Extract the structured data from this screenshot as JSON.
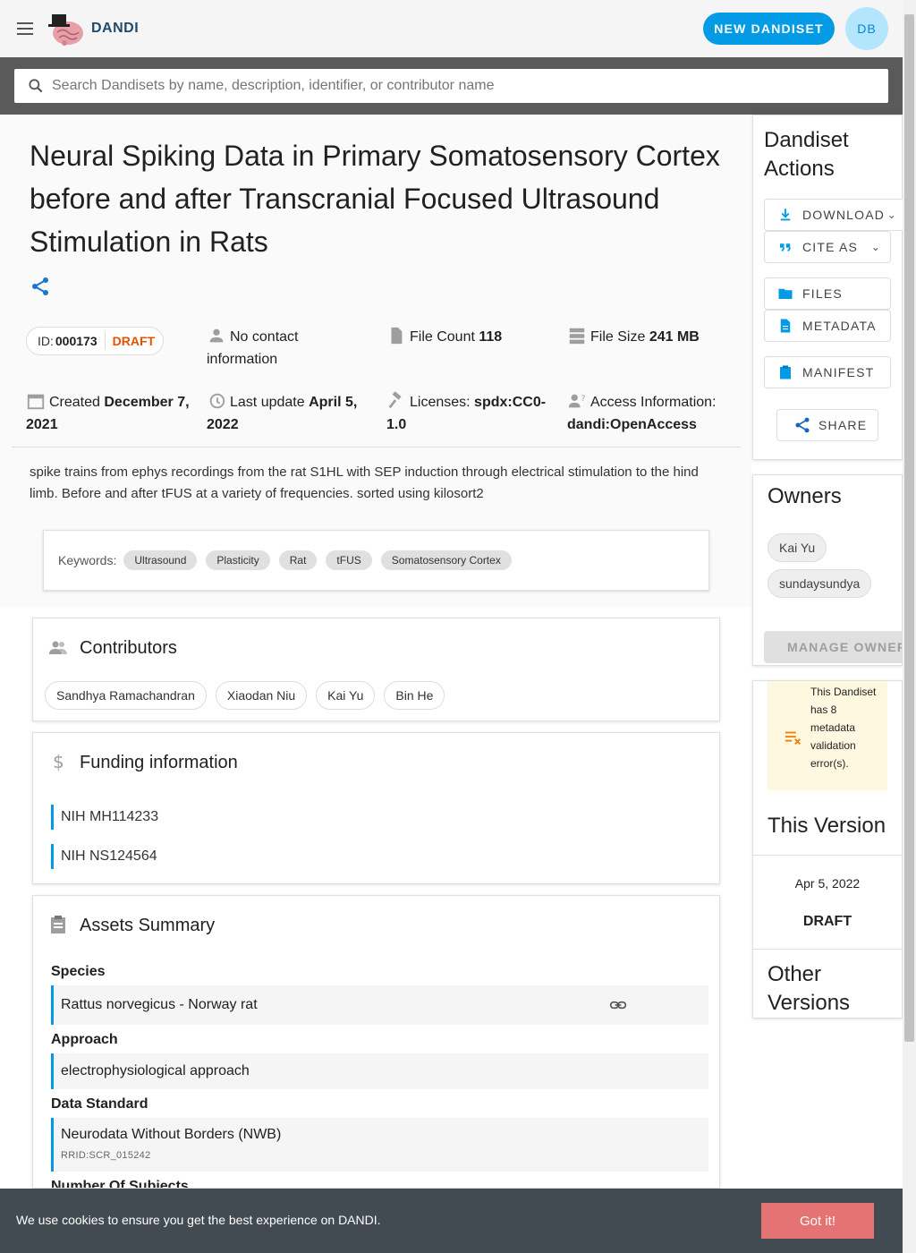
{
  "app": {
    "brand": "DANDI",
    "new_button": "NEW DANDISET",
    "avatar_initials": "DB"
  },
  "search": {
    "placeholder": "Search Dandisets by name, description, identifier, or contributor name"
  },
  "dandiset": {
    "title": "Neural Spiking Data in Primary Somatosensory Cortex before and after Transcranial Focused Ultrasound Stimulation in Rats",
    "id_label": "ID:",
    "id": "000173",
    "status": "DRAFT",
    "contact": "No contact information",
    "file_count_label": "File Count",
    "file_count": "118",
    "file_size_label": "File Size",
    "file_size": "241 MB",
    "created_label": "Created",
    "created": "December 7, 2021",
    "updated_label": "Last update",
    "updated": "April 5, 2022",
    "license_label": "Licenses:",
    "license": "spdx:CC0-1.0",
    "access_label": "Access Information:",
    "access": "dandi:OpenAccess",
    "description": "spike trains from ephys recordings from the rat S1HL with SEP induction through electrical stimulation to the hind limb. Before and after tFUS at a variety of frequencies. sorted using kilosort2",
    "keywords_label": "Keywords:",
    "keywords": [
      "Ultrasound",
      "Plasticity",
      "Rat",
      "tFUS",
      "Somatosensory Cortex"
    ]
  },
  "contributors": {
    "title": "Contributors",
    "people": [
      "Sandhya Ramachandran",
      "Xiaodan Niu",
      "Kai Yu",
      "Bin He"
    ]
  },
  "funding": {
    "title": "Funding information",
    "items": [
      "NIH MH114233",
      "NIH NS124564"
    ]
  },
  "assets": {
    "title": "Assets Summary",
    "species_label": "Species",
    "species": "Rattus norvegicus - Norway rat",
    "approach_label": "Approach",
    "approach": "electrophysiological approach",
    "standard_label": "Data Standard",
    "standard": "Neurodata Without Borders (NWB)",
    "standard_rrid": "RRID:SCR_015242",
    "subjects_label": "Number Of Subjects"
  },
  "sidebar": {
    "actions_title": "Dandiset Actions",
    "download": "DOWNLOAD",
    "cite": "CITE AS",
    "files": "FILES",
    "metadata": "METADATA",
    "manifest": "MANIFEST",
    "share": "SHARE",
    "owners_title": "Owners",
    "owners": [
      "Kai Yu",
      "sundaysundya"
    ],
    "manage_owners": "MANAGE OWNERS",
    "validation_warning": "This Dandiset has 8 metadata validation error(s).",
    "this_version_title": "This Version",
    "version_date": "Apr 5, 2022",
    "version_name": "DRAFT",
    "other_versions_title": "Other Versions"
  },
  "cookie": {
    "text": "We use cookies to ensure you get the best experience on DANDI.",
    "button": "Got it!"
  },
  "colors": {
    "primary": "#039be5",
    "draft": "#e65100",
    "cookie_bg": "#424a52",
    "cookie_btn": "#e57373",
    "warning_bg": "#fff8e1"
  }
}
